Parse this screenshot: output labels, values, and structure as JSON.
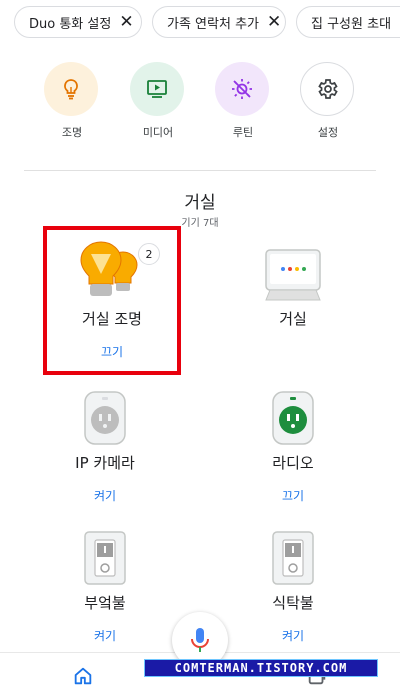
{
  "chips": [
    {
      "label": "Duo 통화 설정"
    },
    {
      "label": "가족 연락처 추가"
    },
    {
      "label": "집 구성원 초대"
    }
  ],
  "shortcuts": [
    {
      "label": "조명",
      "icon": "lightbulb-icon",
      "bg": "#fdf1dc"
    },
    {
      "label": "미디어",
      "icon": "play-icon",
      "bg": "#e2f3ea"
    },
    {
      "label": "루틴",
      "icon": "sun-off-icon",
      "bg": "#f2e6fb"
    },
    {
      "label": "설정",
      "icon": "gear-icon",
      "bg": "#ffffff"
    }
  ],
  "room": {
    "title": "거실",
    "subtitle": "기기 7대"
  },
  "devices": [
    {
      "name": "거실 조명",
      "action": "끄기",
      "badge": "2"
    },
    {
      "name": "거실",
      "action": ""
    },
    {
      "name": "IP 카메라",
      "action": "켜기"
    },
    {
      "name": "라디오",
      "action": "끄기"
    },
    {
      "name": "부엌불",
      "action": "켜기"
    },
    {
      "name": "식탁불",
      "action": "켜기"
    }
  ],
  "colors": {
    "accent": "#1a73e8",
    "highlight": "#e8000d",
    "bulb": "#f9ab00",
    "plug_on": "#1e8e3e"
  },
  "watermark": "COMTERMAN.TISTORY.COM"
}
